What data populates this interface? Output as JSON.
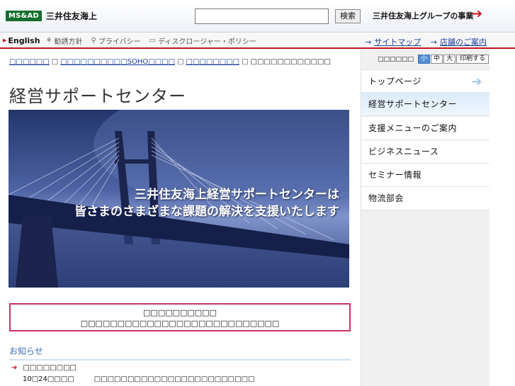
{
  "header": {
    "logo_badge": "MS&AD",
    "logo_name": "三井住友海上",
    "search_placeholder": "",
    "search_button": "検索",
    "group_link": "三井住友海上グループの事業",
    "group_arrow": "➔"
  },
  "subnav": {
    "english": "English",
    "items": [
      {
        "icon": "compass-icon",
        "glyph": "⚘",
        "label": "勧誘方針"
      },
      {
        "icon": "key-icon",
        "glyph": "⚲",
        "label": "プライバシー"
      },
      {
        "icon": "document-icon",
        "glyph": "▭",
        "label": "ディスクロージャー・ポリシー"
      }
    ],
    "right_links": [
      "サイトマップ",
      "店舗のご案内"
    ]
  },
  "breadcrumb": {
    "items": [
      "□□□□□□",
      "□□□□□□□□□□SOHO□□□□",
      "□□□□□□□□",
      "□□□□□□□□□□□□"
    ],
    "separator": "□"
  },
  "page_title": "経営サポートセンター",
  "hero": {
    "line1": "三井住友海上経営サポートセンターは",
    "line2": "皆さまのさまざまな課題の解決を支援いたします"
  },
  "notice": {
    "line1": "□□□□□□□□□□",
    "line2": "□□□□□□□□□□□□□□□□□□□□□□□□□□□"
  },
  "news": {
    "heading": "お知らせ",
    "category": "□□□□□□□□",
    "date": "10□24□□□□",
    "text": "□□□□□□□□□□□□□□□□□□□□□□□□"
  },
  "sidebar": {
    "fontsize_label": "□□□□□□",
    "sizes": [
      "小",
      "中",
      "大"
    ],
    "print": "印刷する",
    "top_item": "トップページ",
    "current_item": "経営サポートセンター",
    "items": [
      "支援メニューのご案内",
      "ビジネスニュース",
      "セミナー情報",
      "物流部会"
    ]
  },
  "colors": {
    "accent_red": "#c2131a",
    "link_blue": "#1b3c9a",
    "logo_green": "#136d2d",
    "notice_border": "#cc2f6a"
  }
}
